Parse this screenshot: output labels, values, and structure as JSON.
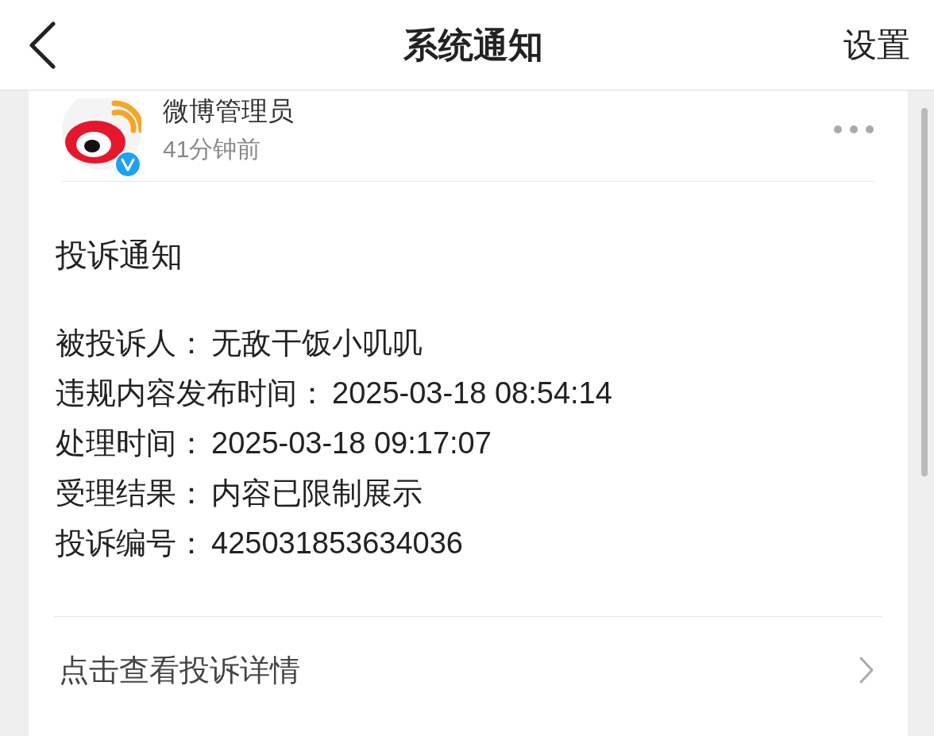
{
  "header": {
    "title": "系统通知",
    "settings": "设置"
  },
  "post": {
    "sender": "微博管理员",
    "verified": true,
    "time": "41分钟前",
    "title": "投诉通知",
    "fields": [
      {
        "label": "被投诉人：",
        "value": "无敌干饭小叽叽"
      },
      {
        "label": "违规内容发布时间：",
        "value": "2025-03-18 08:54:14"
      },
      {
        "label": "处理时间：",
        "value": "2025-03-18 09:17:07"
      },
      {
        "label": "受理结果：",
        "value": "内容已限制展示"
      },
      {
        "label": "投诉编号：",
        "value": "425031853634036"
      }
    ]
  },
  "link": {
    "label": "点击查看投诉详情"
  }
}
